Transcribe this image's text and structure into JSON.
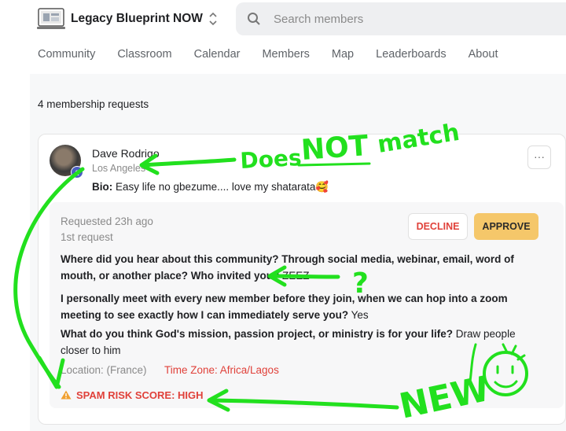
{
  "header": {
    "group_name": "Legacy Blueprint NOW",
    "search_placeholder": "Search members",
    "nav": [
      "Community",
      "Classroom",
      "Calendar",
      "Members",
      "Map",
      "Leaderboards",
      "About"
    ]
  },
  "main": {
    "request_count": "4 membership requests",
    "card": {
      "badge": "1",
      "name": "Dave Rodrigo",
      "location": "Los Angeles",
      "bio_label": "Bio:",
      "bio_text": " Easy life no gbezume.... love my shatarata🥰",
      "more": "···",
      "requested": "Requested 23h ago",
      "request_number": "1st request",
      "decline_label": "DECLINE",
      "approve_label": "APPROVE",
      "answers": [
        {
          "q": "Where did you hear about this community? Through social media, webinar, email, word of mouth, or another place? Who invited you?",
          "a": " ZEEZ"
        },
        {
          "q": "I personally meet with every new member before they join, when we can hop into a zoom meeting to see exactly how I can immediately serve you?",
          "a": " Yes"
        },
        {
          "q": "What do you think God's mission, passion project, or ministry is for your life?",
          "a": " Draw people closer to him"
        }
      ],
      "location_line": "Location: (France)",
      "timezone_line": "Time Zone: Africa/Lagos",
      "spam_risk": "SPAM RISK SCORE: HIGH"
    }
  },
  "annotations": {
    "does": "Does",
    "not": "NOT",
    "match": "match",
    "question": "?",
    "new": "NEW",
    "color": "#22e01e"
  },
  "icons": [
    "logo",
    "switcher-chevrons-icon",
    "search-icon",
    "more-icon",
    "warning-icon"
  ],
  "colors": {
    "accent_red": "#e0413a",
    "approve_bg": "#f5c76a",
    "annotation_green": "#22e01e"
  }
}
